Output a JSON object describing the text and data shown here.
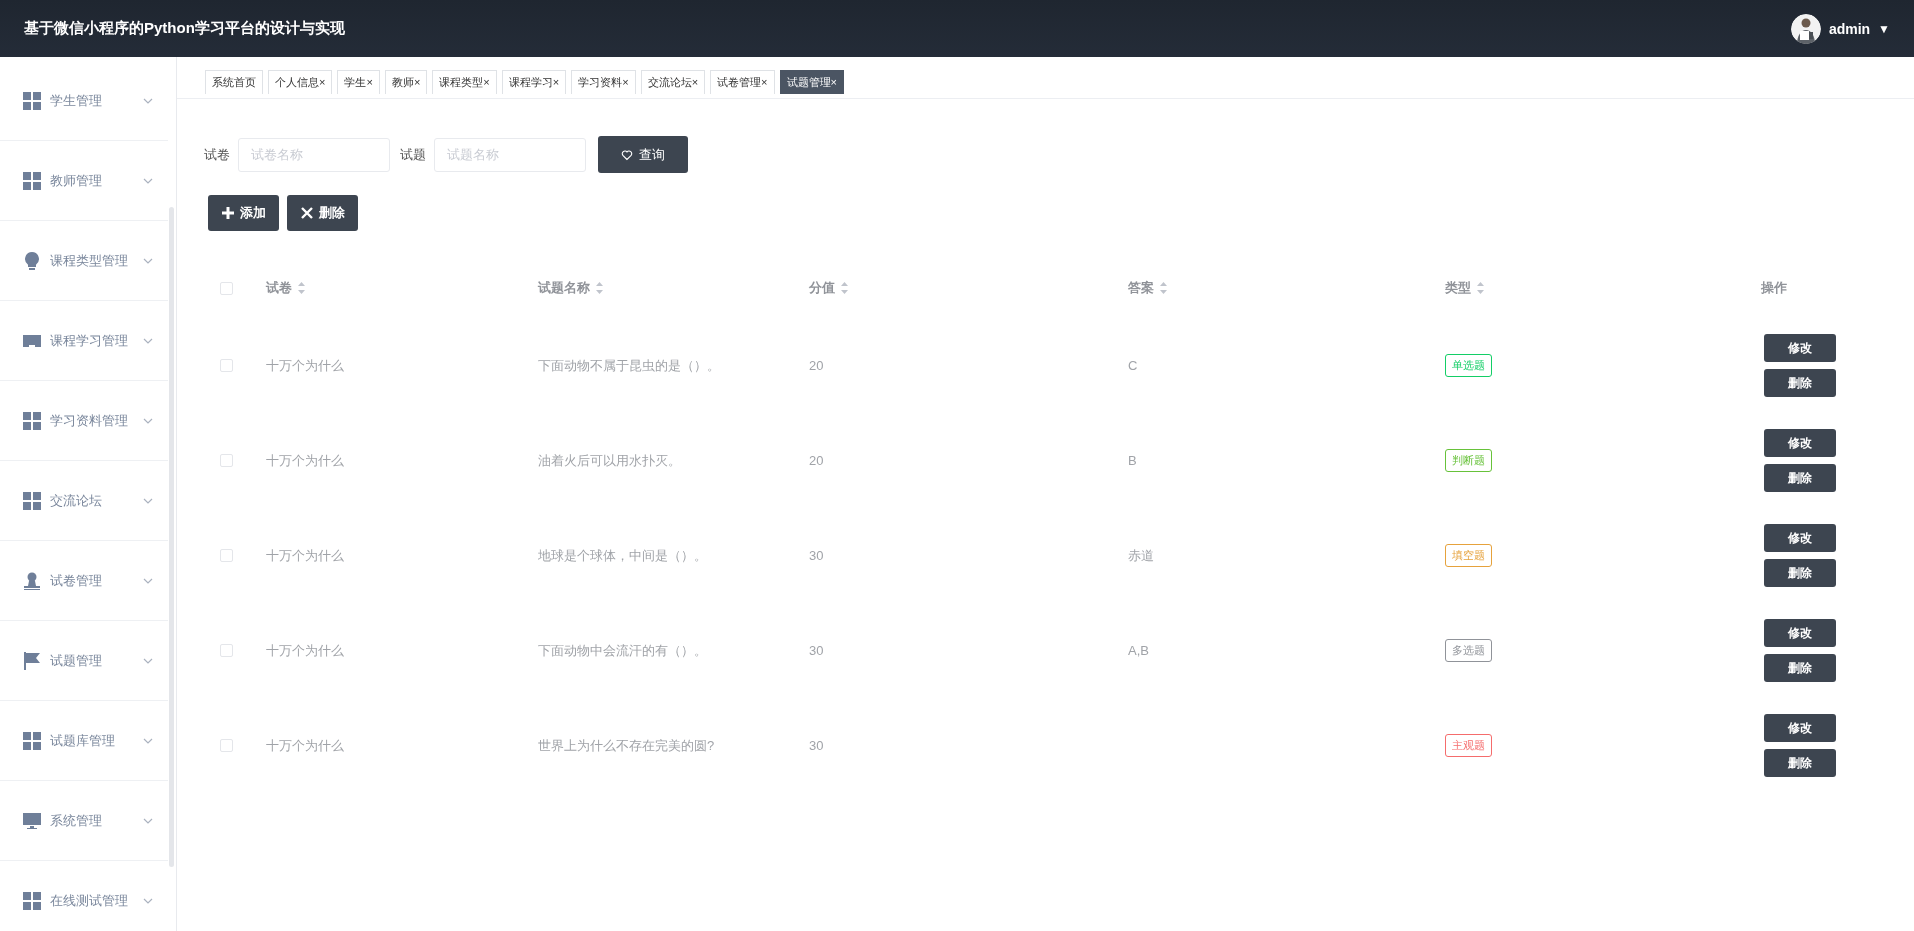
{
  "header": {
    "title": "基于微信小程序的Python学习平台的设计与实现",
    "user": {
      "name": "admin",
      "caret": "▼"
    }
  },
  "sidebar": {
    "items": [
      {
        "label": "学生管理",
        "kind": "grid",
        "expanded": false
      },
      {
        "label": "教师管理",
        "kind": "grid",
        "expanded": false
      },
      {
        "label": "课程类型管理",
        "kind": "bulb",
        "expanded": false
      },
      {
        "label": "课程学习管理",
        "kind": "tray",
        "expanded": false
      },
      {
        "label": "学习资料管理",
        "kind": "grid",
        "expanded": false
      },
      {
        "label": "交流论坛",
        "kind": "grid",
        "expanded": false
      },
      {
        "label": "试卷管理",
        "kind": "stamp",
        "expanded": false
      },
      {
        "label": "试题管理",
        "kind": "flag",
        "expanded": false
      },
      {
        "label": "试题库管理",
        "kind": "grid",
        "expanded": false
      },
      {
        "label": "系统管理",
        "kind": "monitor",
        "expanded": false
      },
      {
        "label": "在线测试管理",
        "kind": "grid",
        "expanded": false
      }
    ]
  },
  "tabs": [
    {
      "label": "系统首页",
      "selected": false
    },
    {
      "label": "个人信息",
      "close": "×",
      "selected": false
    },
    {
      "label": "学生",
      "close": "×",
      "selected": false
    },
    {
      "label": "教师",
      "close": "×",
      "selected": false
    },
    {
      "label": "课程类型",
      "close": "×",
      "selected": false
    },
    {
      "label": "课程学习",
      "close": "×",
      "selected": false
    },
    {
      "label": "学习资料",
      "close": "×",
      "selected": false
    },
    {
      "label": "交流论坛",
      "close": "×",
      "selected": false
    },
    {
      "label": "试卷管理",
      "close": "×",
      "selected": false
    },
    {
      "label": "试题管理",
      "close": "×",
      "selected": true
    }
  ],
  "search": {
    "fields": [
      {
        "label": "试卷",
        "placeholder": "试卷名称"
      },
      {
        "label": "试题",
        "placeholder": "试题名称"
      }
    ],
    "button": "查询"
  },
  "actions": [
    {
      "label": "添加",
      "kind": "add"
    },
    {
      "label": "删除",
      "kind": "delete"
    }
  ],
  "table": {
    "all_checked": false,
    "columns": [
      {
        "label": "试卷",
        "sortable": true
      },
      {
        "label": "试题名称",
        "sortable": true
      },
      {
        "label": "分值",
        "sortable": true
      },
      {
        "label": "答案",
        "sortable": true
      },
      {
        "label": "类型",
        "sortable": true
      },
      {
        "label": "操作",
        "sortable": false
      }
    ],
    "rows": [
      {
        "checked": false,
        "paper": "十万个为什么",
        "question": "下面动物不属于昆虫的是（）。",
        "score": "20",
        "answer": "C",
        "type": {
          "label": "单选题",
          "color": "#13ce66"
        },
        "buttons": [
          "修改",
          "删除"
        ]
      },
      {
        "checked": false,
        "paper": "十万个为什么",
        "question": "油着火后可以用水扑灭。",
        "score": "20",
        "answer": "B",
        "type": {
          "label": "判断题",
          "color": "#67c23a"
        },
        "buttons": [
          "修改",
          "删除"
        ]
      },
      {
        "checked": false,
        "paper": "十万个为什么",
        "question": "地球是个球体，中间是（）。",
        "score": "30",
        "answer": "赤道",
        "type": {
          "label": "填空题",
          "color": "#e6a23c"
        },
        "buttons": [
          "修改",
          "删除"
        ]
      },
      {
        "checked": false,
        "paper": "十万个为什么",
        "question": "下面动物中会流汗的有（）。",
        "score": "30",
        "answer": "A,B",
        "type": {
          "label": "多选题",
          "color": "#909399"
        },
        "buttons": [
          "修改",
          "删除"
        ]
      },
      {
        "checked": false,
        "paper": "十万个为什么",
        "question": "世界上为什么不存在完美的圆?",
        "score": "30",
        "type": {
          "label": "主观题",
          "color": "#f56c6c"
        },
        "buttons": [
          "修改",
          "删除"
        ]
      }
    ]
  }
}
